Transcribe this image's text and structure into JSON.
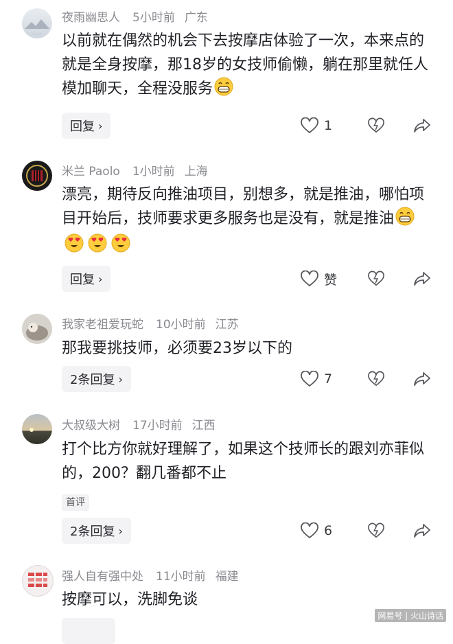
{
  "comments": [
    {
      "user": "夜雨幽思人",
      "time": "5小时前",
      "location": "广东",
      "text": "以前就在偶然的机会下去按摩店体验了一次，本来点的就是全身按摩，那18岁的女技师偷懒，躺在那里就任人模加聊天，全程没服务",
      "emojis": [
        "grin"
      ],
      "reply_label": "回复",
      "like_count": "1"
    },
    {
      "user": "米兰 Paolo",
      "time": "1小时前",
      "location": "上海",
      "text": "漂亮，期待反向推油项目，别想多，就是推油，哪怕项目开始后，技师要求更多服务也是没有，就是推油",
      "emojis": [
        "grin",
        "heart-eyes",
        "heart-eyes",
        "heart-eyes"
      ],
      "reply_label": "回复",
      "like_count": "赞"
    },
    {
      "user": "我家老祖爱玩蛇",
      "time": "10小时前",
      "location": "江苏",
      "text": "那我要挑技师，必须要23岁以下的",
      "emojis": [],
      "reply_label": "2条回复",
      "like_count": "7"
    },
    {
      "user": "大叔级大树",
      "time": "17小时前",
      "location": "江西",
      "text": "打个比方你就好理解了，如果这个技师长的跟刘亦菲似的，200？翻几番都不止",
      "emojis": [],
      "badge": "首评",
      "reply_label": "2条回复",
      "like_count": "6"
    },
    {
      "user": "强人自有强中处",
      "time": "11小时前",
      "location": "福建",
      "text": "按摩可以，洗脚免谈",
      "emojis": []
    }
  ],
  "watermark": "网易号 | 火山诗话",
  "colors": {
    "meta": "#8a8b91",
    "text": "#1f2026",
    "icon": "#55565b",
    "reply_bg": "#f3f3f5"
  },
  "icons": [
    "heart-outline-icon",
    "dislike-heart-icon",
    "share-icon",
    "chevron-right-icon"
  ]
}
